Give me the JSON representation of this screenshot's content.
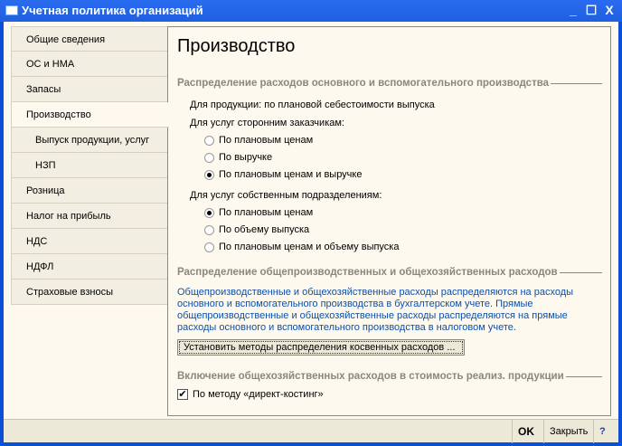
{
  "window": {
    "title": "Учетная политика организаций",
    "minimize": "_",
    "maximize": "☐",
    "close": "X"
  },
  "tabs": [
    {
      "label": "Общие сведения"
    },
    {
      "label": "ОС и НМА"
    },
    {
      "label": "Запасы"
    },
    {
      "label": "Производство",
      "selected": true
    },
    {
      "label": "Выпуск продукции, услуг",
      "sub": true
    },
    {
      "label": "НЗП",
      "sub": true
    },
    {
      "label": "Розница"
    },
    {
      "label": "Налог на прибыль"
    },
    {
      "label": "НДС"
    },
    {
      "label": "НДФЛ"
    },
    {
      "label": "Страховые взносы"
    }
  ],
  "content": {
    "title": "Производство",
    "group1": "Распределение расходов основного и вспомогательного производства",
    "products_line": "Для продукции: по плановой себестоимости выпуска",
    "external_label": "Для услуг сторонним заказчикам:",
    "external_options": [
      {
        "label": "По плановым ценам",
        "checked": false
      },
      {
        "label": "По выручке",
        "checked": false
      },
      {
        "label": "По плановым ценам и выручке",
        "checked": true
      }
    ],
    "internal_label": "Для услуг собственным подразделениям:",
    "internal_options": [
      {
        "label": "По плановым ценам",
        "checked": true
      },
      {
        "label": "По объему выпуска",
        "checked": false
      },
      {
        "label": "По плановым ценам и объему выпуска",
        "checked": false
      }
    ],
    "group2": "Распределение общепроизводственных и общехозяйственных расходов",
    "info": "Общепроизводственные и общехозяйственные расходы распределяются на расходы основного и вспомогательного производства в бухгалтерском учете. Прямые общепроизводственные и общехозяйственные расходы распределяются на прямые расходы основного и вспомогательного производства в налоговом учете.",
    "set_methods_button": "Установить методы распределения косвенных расходов ...",
    "group3": "Включение общехозяйственных расходов в стоимость реализ. продукции",
    "direct_costing_label": "По методу «директ-костинг»",
    "direct_costing_checked": true
  },
  "footer": {
    "ok": "OK",
    "close": "Закрыть",
    "help": "?"
  }
}
